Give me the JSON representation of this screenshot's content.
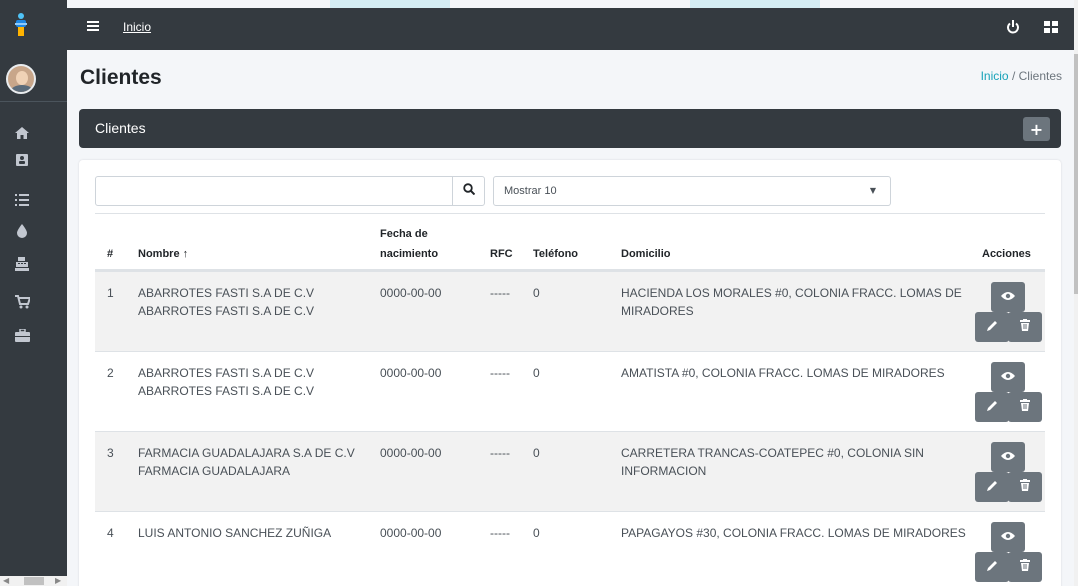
{
  "topbar": {
    "home_link": "Inicio"
  },
  "page": {
    "title": "Clientes"
  },
  "breadcrumb": {
    "home": "Inicio",
    "separator": "/",
    "current": "Clientes"
  },
  "card": {
    "title": "Clientes",
    "add_label": "+"
  },
  "search": {
    "value": "",
    "select_value": "Mostrar 10"
  },
  "table": {
    "headers": {
      "num": "#",
      "nombre": "Nombre ↑",
      "fecha_1": "Fecha de",
      "fecha_2": "nacimiento",
      "rfc": "RFC",
      "telefono": "Teléfono",
      "domicilio": "Domicilio",
      "acciones": "Acciones"
    },
    "rows": [
      {
        "num": "1",
        "nombre": "ABARROTES FASTI S.A DE C.V ABARROTES FASTI S.A DE C.V",
        "fecha": "0000-00-00",
        "rfc": "-----",
        "telefono": "0",
        "domicilio": "HACIENDA LOS MORALES #0, COLONIA FRACC. LOMAS DE MIRADORES"
      },
      {
        "num": "2",
        "nombre": "ABARROTES FASTI S.A DE C.V ABARROTES FASTI S.A DE C.V",
        "fecha": "0000-00-00",
        "rfc": "-----",
        "telefono": "0",
        "domicilio": "AMATISTA #0, COLONIA FRACC. LOMAS DE MIRADORES"
      },
      {
        "num": "3",
        "nombre": "FARMACIA GUADALAJARA S.A DE C.V FARMACIA GUADALAJARA",
        "fecha": "0000-00-00",
        "rfc": "-----",
        "telefono": "0",
        "domicilio": "CARRETERA TRANCAS-COATEPEC #0, COLONIA SIN INFORMACION"
      },
      {
        "num": "4",
        "nombre": "LUIS ANTONIO SANCHEZ ZUÑIGA",
        "fecha": "0000-00-00",
        "rfc": "-----",
        "telefono": "0",
        "domicilio": "PAPAGAYOS #30, COLONIA FRACC. LOMAS DE MIRADORES"
      }
    ]
  },
  "colors": {
    "dark": "#343a40",
    "accent": "#17a2b8",
    "button": "#6c757d",
    "stripe": "#f2f2f2"
  },
  "icons": [
    "logo-icon",
    "home-icon",
    "contact-card-icon",
    "list-icon",
    "drop-icon",
    "cash-register-icon",
    "cart-icon",
    "toolbox-icon",
    "menu-icon",
    "power-icon",
    "apps-icon",
    "search-icon",
    "eye-icon",
    "pencil-icon",
    "trash-icon"
  ]
}
